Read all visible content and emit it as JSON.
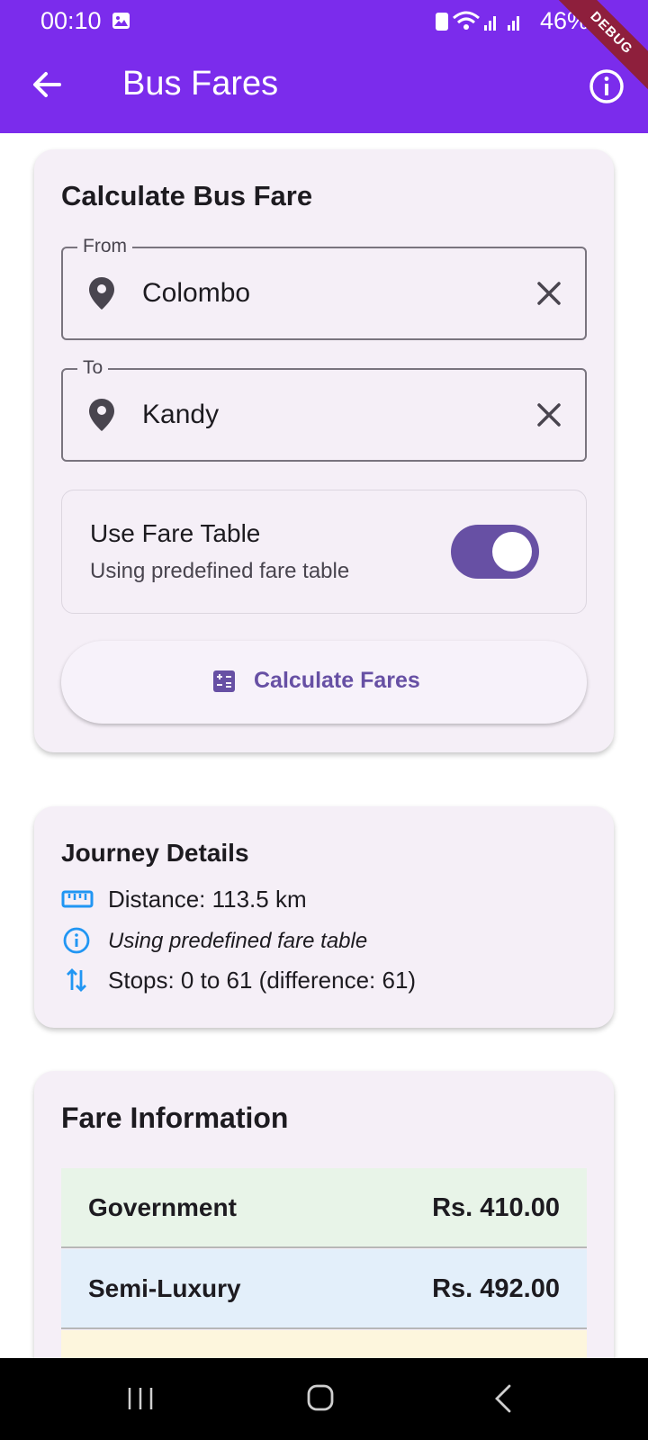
{
  "status_bar": {
    "time": "00:10",
    "battery": "46%"
  },
  "app_bar": {
    "title": "Bus Fares",
    "debug_banner": "DEBUG"
  },
  "calculator": {
    "title": "Calculate Bus Fare",
    "from": {
      "label": "From",
      "value": "Colombo"
    },
    "to": {
      "label": "To",
      "value": "Kandy"
    },
    "fare_table_toggle": {
      "title": "Use Fare Table",
      "subtitle": "Using predefined fare table",
      "on": true
    },
    "calculate_button": "Calculate Fares"
  },
  "journey": {
    "title": "Journey Details",
    "distance": "Distance: 113.5 km",
    "mode": "Using predefined fare table",
    "stops": "Stops: 0 to 61 (difference: 61)"
  },
  "fares": {
    "title": "Fare Information",
    "rows": [
      {
        "name": "Government",
        "price": "Rs. 410.00"
      },
      {
        "name": "Semi-Luxury",
        "price": "Rs. 492.00"
      },
      {
        "name": "",
        "price": ""
      }
    ]
  },
  "colors": {
    "app_bar": "#7b2cec",
    "accent": "#6750a4",
    "card": "#f5eff7",
    "detail_icons": "#2196f3"
  }
}
